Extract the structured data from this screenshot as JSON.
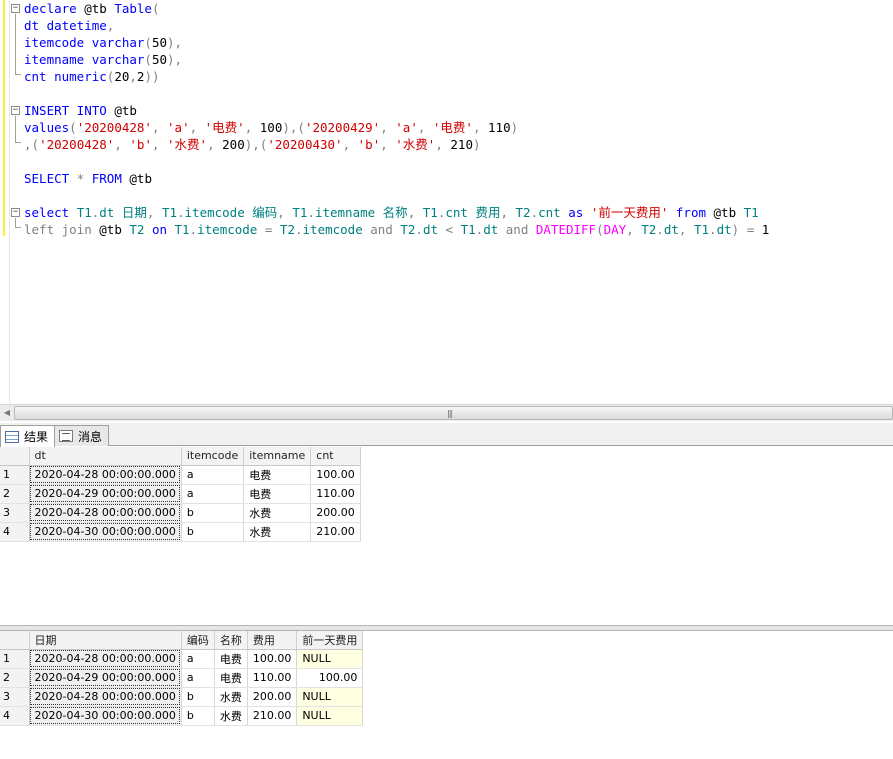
{
  "editor": {
    "lines": [
      {
        "segs": [
          {
            "c": "kw",
            "t": "declare "
          },
          {
            "c": "",
            "t": "@tb "
          },
          {
            "c": "kw",
            "t": "Table"
          },
          {
            "c": "op",
            "t": "("
          }
        ]
      },
      {
        "segs": [
          {
            "c": "kw",
            "t": "dt datetime"
          },
          {
            "c": "op",
            "t": ","
          }
        ]
      },
      {
        "segs": [
          {
            "c": "kw",
            "t": "itemcode varchar"
          },
          {
            "c": "op",
            "t": "("
          },
          {
            "c": "",
            "t": "50"
          },
          {
            "c": "op",
            "t": "),"
          }
        ]
      },
      {
        "segs": [
          {
            "c": "kw",
            "t": "itemname varchar"
          },
          {
            "c": "op",
            "t": "("
          },
          {
            "c": "",
            "t": "50"
          },
          {
            "c": "op",
            "t": "),"
          }
        ]
      },
      {
        "segs": [
          {
            "c": "kw",
            "t": "cnt numeric"
          },
          {
            "c": "op",
            "t": "("
          },
          {
            "c": "",
            "t": "20"
          },
          {
            "c": "op",
            "t": ","
          },
          {
            "c": "",
            "t": "2"
          },
          {
            "c": "op",
            "t": "))"
          }
        ]
      },
      {
        "segs": []
      },
      {
        "segs": [
          {
            "c": "kw",
            "t": "INSERT INTO "
          },
          {
            "c": "",
            "t": "@tb"
          }
        ]
      },
      {
        "segs": [
          {
            "c": "kw",
            "t": "values"
          },
          {
            "c": "op",
            "t": "("
          },
          {
            "c": "str",
            "t": "'20200428'"
          },
          {
            "c": "op",
            "t": ", "
          },
          {
            "c": "str",
            "t": "'a'"
          },
          {
            "c": "op",
            "t": ", "
          },
          {
            "c": "str",
            "t": "'电费'"
          },
          {
            "c": "op",
            "t": ", "
          },
          {
            "c": "",
            "t": "100"
          },
          {
            "c": "op",
            "t": "),("
          },
          {
            "c": "str",
            "t": "'20200429'"
          },
          {
            "c": "op",
            "t": ", "
          },
          {
            "c": "str",
            "t": "'a'"
          },
          {
            "c": "op",
            "t": ", "
          },
          {
            "c": "str",
            "t": "'电费'"
          },
          {
            "c": "op",
            "t": ", "
          },
          {
            "c": "",
            "t": "110"
          },
          {
            "c": "op",
            "t": ")"
          }
        ]
      },
      {
        "segs": [
          {
            "c": "op",
            "t": ",("
          },
          {
            "c": "str",
            "t": "'20200428'"
          },
          {
            "c": "op",
            "t": ", "
          },
          {
            "c": "str",
            "t": "'b'"
          },
          {
            "c": "op",
            "t": ", "
          },
          {
            "c": "str",
            "t": "'水费'"
          },
          {
            "c": "op",
            "t": ", "
          },
          {
            "c": "",
            "t": "200"
          },
          {
            "c": "op",
            "t": "),("
          },
          {
            "c": "str",
            "t": "'20200430'"
          },
          {
            "c": "op",
            "t": ", "
          },
          {
            "c": "str",
            "t": "'b'"
          },
          {
            "c": "op",
            "t": ", "
          },
          {
            "c": "str",
            "t": "'水费'"
          },
          {
            "c": "op",
            "t": ", "
          },
          {
            "c": "",
            "t": "210"
          },
          {
            "c": "op",
            "t": ")"
          }
        ]
      },
      {
        "segs": []
      },
      {
        "segs": [
          {
            "c": "kw",
            "t": "SELECT "
          },
          {
            "c": "op",
            "t": "* "
          },
          {
            "c": "kw",
            "t": "FROM "
          },
          {
            "c": "",
            "t": "@tb"
          }
        ]
      },
      {
        "segs": []
      },
      {
        "segs": [
          {
            "c": "kw",
            "t": "select "
          },
          {
            "c": "id",
            "t": "T1"
          },
          {
            "c": "op",
            "t": "."
          },
          {
            "c": "id",
            "t": "dt "
          },
          {
            "c": "id",
            "t": "日期"
          },
          {
            "c": "op",
            "t": ", "
          },
          {
            "c": "id",
            "t": "T1"
          },
          {
            "c": "op",
            "t": "."
          },
          {
            "c": "id",
            "t": "itemcode "
          },
          {
            "c": "id",
            "t": "编码"
          },
          {
            "c": "op",
            "t": ", "
          },
          {
            "c": "id",
            "t": "T1"
          },
          {
            "c": "op",
            "t": "."
          },
          {
            "c": "id",
            "t": "itemname "
          },
          {
            "c": "id",
            "t": "名称"
          },
          {
            "c": "op",
            "t": ", "
          },
          {
            "c": "id",
            "t": "T1"
          },
          {
            "c": "op",
            "t": "."
          },
          {
            "c": "id",
            "t": "cnt "
          },
          {
            "c": "id",
            "t": "费用"
          },
          {
            "c": "op",
            "t": ", "
          },
          {
            "c": "id",
            "t": "T2"
          },
          {
            "c": "op",
            "t": "."
          },
          {
            "c": "id",
            "t": "cnt "
          },
          {
            "c": "kw",
            "t": "as "
          },
          {
            "c": "str",
            "t": "'前一天费用' "
          },
          {
            "c": "kw",
            "t": "from "
          },
          {
            "c": "",
            "t": "@tb "
          },
          {
            "c": "id",
            "t": "T1"
          }
        ]
      },
      {
        "segs": [
          {
            "c": "gr",
            "t": "left join "
          },
          {
            "c": "",
            "t": "@tb "
          },
          {
            "c": "id",
            "t": "T2 "
          },
          {
            "c": "kw",
            "t": "on "
          },
          {
            "c": "id",
            "t": "T1"
          },
          {
            "c": "op",
            "t": "."
          },
          {
            "c": "id",
            "t": "itemcode "
          },
          {
            "c": "op",
            "t": "= "
          },
          {
            "c": "id",
            "t": "T2"
          },
          {
            "c": "op",
            "t": "."
          },
          {
            "c": "id",
            "t": "itemcode "
          },
          {
            "c": "gr",
            "t": "and "
          },
          {
            "c": "id",
            "t": "T2"
          },
          {
            "c": "op",
            "t": "."
          },
          {
            "c": "id",
            "t": "dt "
          },
          {
            "c": "op",
            "t": "< "
          },
          {
            "c": "id",
            "t": "T1"
          },
          {
            "c": "op",
            "t": "."
          },
          {
            "c": "id",
            "t": "dt "
          },
          {
            "c": "gr",
            "t": "and "
          },
          {
            "c": "fn",
            "t": "DATEDIFF"
          },
          {
            "c": "op",
            "t": "("
          },
          {
            "c": "fn",
            "t": "DAY"
          },
          {
            "c": "op",
            "t": ", "
          },
          {
            "c": "id",
            "t": "T2"
          },
          {
            "c": "op",
            "t": "."
          },
          {
            "c": "id",
            "t": "dt"
          },
          {
            "c": "op",
            "t": ", "
          },
          {
            "c": "id",
            "t": "T1"
          },
          {
            "c": "op",
            "t": "."
          },
          {
            "c": "id",
            "t": "dt"
          },
          {
            "c": "op",
            "t": ") = "
          },
          {
            "c": "",
            "t": "1"
          }
        ]
      }
    ]
  },
  "tabs": {
    "results_label": "结果",
    "messages_label": "消息"
  },
  "grid1": {
    "columns": [
      "dt",
      "itemcode",
      "itemname",
      "cnt"
    ],
    "rows": [
      [
        "1",
        "2020-04-28 00:00:00.000",
        "a",
        "电费",
        "100.00"
      ],
      [
        "2",
        "2020-04-29 00:00:00.000",
        "a",
        "电费",
        "110.00"
      ],
      [
        "3",
        "2020-04-28 00:00:00.000",
        "b",
        "水费",
        "200.00"
      ],
      [
        "4",
        "2020-04-30 00:00:00.000",
        "b",
        "水费",
        "210.00"
      ]
    ]
  },
  "grid2": {
    "columns": [
      "日期",
      "编码",
      "名称",
      "费用",
      "前一天费用"
    ],
    "rows": [
      [
        "1",
        "2020-04-28 00:00:00.000",
        "a",
        "电费",
        "100.00",
        "NULL"
      ],
      [
        "2",
        "2020-04-29 00:00:00.000",
        "a",
        "电费",
        "110.00",
        "100.00"
      ],
      [
        "3",
        "2020-04-28 00:00:00.000",
        "b",
        "水费",
        "200.00",
        "NULL"
      ],
      [
        "4",
        "2020-04-30 00:00:00.000",
        "b",
        "水费",
        "210.00",
        "NULL"
      ]
    ]
  },
  "colors": {
    "keyword": "#0000ff",
    "string": "#d00000",
    "operator": "#808080",
    "function": "#ff00ff",
    "identifier": "#008080",
    "null_cell": "#ffffe1"
  }
}
